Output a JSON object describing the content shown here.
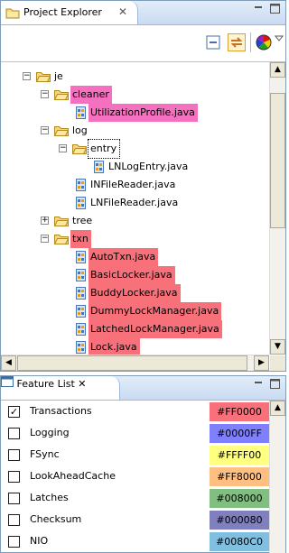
{
  "project_explorer": {
    "tab_title": "Project Explorer",
    "tree": [
      {
        "label": "je",
        "type": "folder",
        "depth": 0,
        "expander": "minus",
        "highlight": ""
      },
      {
        "label": "cleaner",
        "type": "folder",
        "depth": 1,
        "expander": "minus",
        "highlight": "pink"
      },
      {
        "label": "UtilizationProfile.java",
        "type": "file",
        "depth": 2,
        "expander": "",
        "highlight": "pink"
      },
      {
        "label": "log",
        "type": "folder",
        "depth": 1,
        "expander": "minus",
        "highlight": ""
      },
      {
        "label": "entry",
        "type": "folder",
        "depth": 2,
        "expander": "minus",
        "highlight": "",
        "focused": true
      },
      {
        "label": "LNLogEntry.java",
        "type": "file",
        "depth": 3,
        "expander": "",
        "highlight": ""
      },
      {
        "label": "INFileReader.java",
        "type": "file",
        "depth": 2,
        "expander": "",
        "highlight": ""
      },
      {
        "label": "LNFileReader.java",
        "type": "file",
        "depth": 2,
        "expander": "",
        "highlight": ""
      },
      {
        "label": "tree",
        "type": "folder",
        "depth": 1,
        "expander": "plus",
        "highlight": ""
      },
      {
        "label": "txn",
        "type": "folder",
        "depth": 1,
        "expander": "minus",
        "highlight": "red"
      },
      {
        "label": "AutoTxn.java",
        "type": "file",
        "depth": 2,
        "expander": "",
        "highlight": "red"
      },
      {
        "label": "BasicLocker.java",
        "type": "file",
        "depth": 2,
        "expander": "",
        "highlight": "red"
      },
      {
        "label": "BuddyLocker.java",
        "type": "file",
        "depth": 2,
        "expander": "",
        "highlight": "red"
      },
      {
        "label": "DummyLockManager.java",
        "type": "file",
        "depth": 2,
        "expander": "",
        "highlight": "red"
      },
      {
        "label": "LatchedLockManager.java",
        "type": "file",
        "depth": 2,
        "expander": "",
        "highlight": "red"
      },
      {
        "label": "Lock.java",
        "type": "file",
        "depth": 2,
        "expander": "",
        "highlight": "red"
      }
    ]
  },
  "feature_list": {
    "tab_title": "Feature List",
    "features": [
      {
        "name": "Transactions",
        "checked": true,
        "color": "#FF0000",
        "swatch": "#f7707a"
      },
      {
        "name": "Logging",
        "checked": false,
        "color": "#0000FF",
        "swatch": "#7f80ff"
      },
      {
        "name": "FSync",
        "checked": false,
        "color": "#FFFF00",
        "swatch": "#ffff80"
      },
      {
        "name": "LookAheadCache",
        "checked": false,
        "color": "#FF8000",
        "swatch": "#ffbf80"
      },
      {
        "name": "Latches",
        "checked": false,
        "color": "#008000",
        "swatch": "#80bf80"
      },
      {
        "name": "Checksum",
        "checked": false,
        "color": "#000080",
        "swatch": "#8080bf"
      },
      {
        "name": "NIO",
        "checked": false,
        "color": "#0080C0",
        "swatch": "#80bfe0"
      }
    ]
  },
  "icons": [
    "folder-icon",
    "java-file-icon",
    "close-icon",
    "minimize-icon",
    "maximize-icon",
    "collapse-all-icon",
    "link-editor-icon",
    "color-wheel-icon",
    "view-menu-icon",
    "feature-list-icon"
  ]
}
